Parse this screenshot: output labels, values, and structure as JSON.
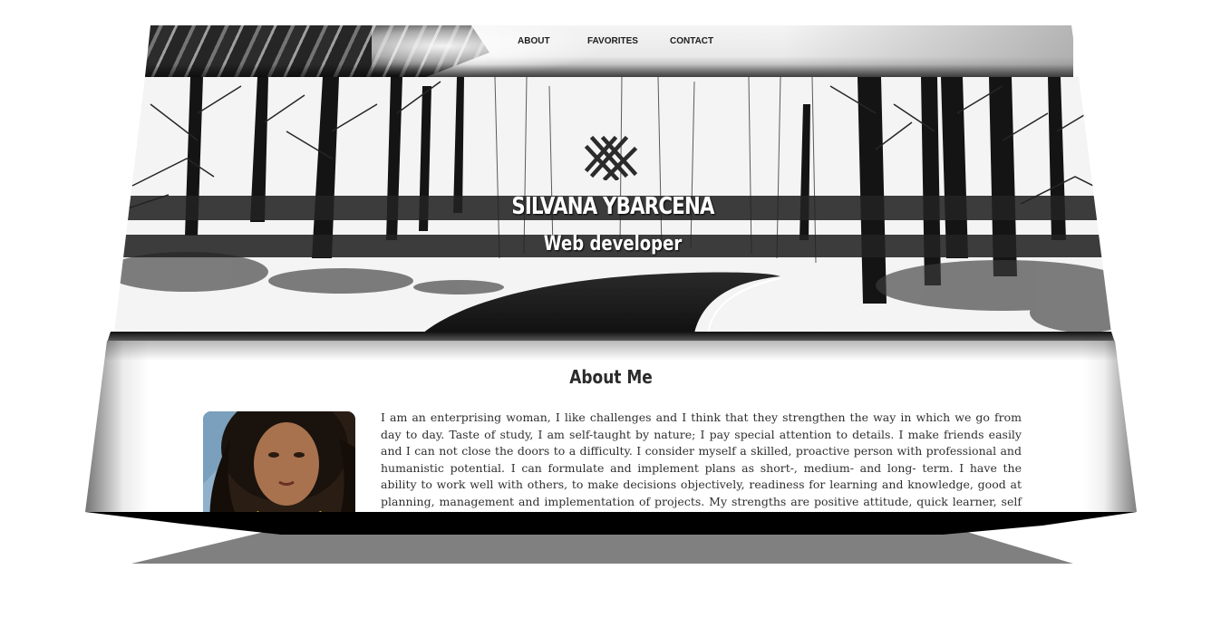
{
  "nav": {
    "items": [
      {
        "label": "ABOUT"
      },
      {
        "label": "FAVORITES"
      },
      {
        "label": "CONTACT"
      }
    ]
  },
  "hero": {
    "name": "SILVANA YBARCENA",
    "role": "Web developer",
    "logo_icon": "crosshatch-logo-icon"
  },
  "about": {
    "title": "About Me",
    "avatar_icon": "profile-photo",
    "text": "I am an enterprising woman, I like challenges and I think that they strengthen the way in which we go from day to day. Taste of study, I am self-taught by nature; I pay special attention to details. I make friends easily and I can not close the doors to a difficulty. I consider myself a skilled, proactive person with professional and humanistic potential. I can formulate and implement plans as short-, medium- and long- term. I have the ability to work well with others, to make decisions objectively, readiness for learning and knowledge, good at planning, management and implementation of projects. My strengths are positive attitude, quick learner, self learner, friendly nature, confident"
  },
  "colors": {
    "band": "#222222",
    "hero_text": "#ffffff",
    "body_text": "#2f2f2f",
    "floor_shadow": "#808080",
    "slab": "#000000"
  }
}
